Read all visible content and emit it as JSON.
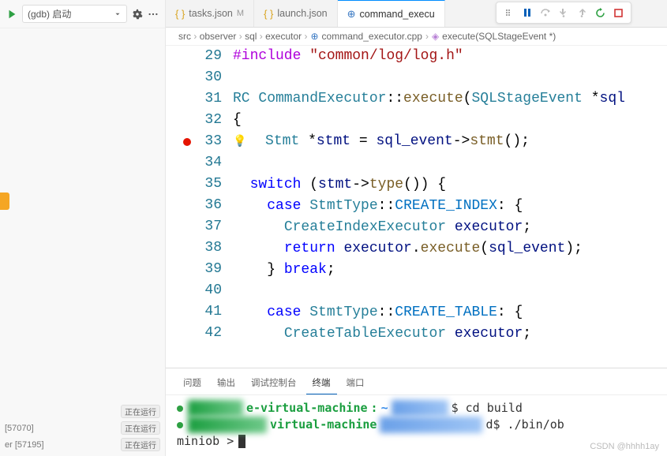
{
  "sidebar": {
    "config_label": "(gdb) 启动",
    "processes": [
      {
        "label": "[57070]",
        "status": "正在运行"
      },
      {
        "label": "er [57195]",
        "status": "正在运行"
      }
    ]
  },
  "tabs": [
    {
      "label": "tasks.json",
      "modified": "M",
      "icon": "json",
      "active": false
    },
    {
      "label": "launch.json",
      "icon": "json",
      "active": false
    },
    {
      "label": "command_execu",
      "icon": "cpp",
      "active": true
    }
  ],
  "breadcrumb": {
    "path": [
      "src",
      "observer",
      "sql",
      "executor"
    ],
    "file": "command_executor.cpp",
    "symbol": "execute(SQLStageEvent *)"
  },
  "editor": {
    "lines": [
      {
        "n": 29,
        "seg": [
          [
            "pp",
            "#include"
          ],
          [
            "punct",
            " "
          ],
          [
            "str",
            "\"common/log/log.h\""
          ]
        ]
      },
      {
        "n": 30,
        "seg": []
      },
      {
        "n": 31,
        "seg": [
          [
            "type",
            "RC "
          ],
          [
            "type",
            "CommandExecutor"
          ],
          [
            "punct",
            "::"
          ],
          [
            "fn",
            "execute"
          ],
          [
            "punct",
            "("
          ],
          [
            "type",
            "SQLStageEvent "
          ],
          [
            "punct",
            "*"
          ],
          [
            "ident",
            "sql"
          ]
        ]
      },
      {
        "n": 32,
        "seg": [
          [
            "punct",
            "{"
          ]
        ]
      },
      {
        "n": 33,
        "bulb": true,
        "bp": true,
        "seg": [
          [
            "punct",
            "  "
          ],
          [
            "type",
            "Stmt "
          ],
          [
            "punct",
            "*"
          ],
          [
            "ident",
            "stmt"
          ],
          [
            "punct",
            " = "
          ],
          [
            "ident",
            "sql_event"
          ],
          [
            "punct",
            "->"
          ],
          [
            "fn",
            "stmt"
          ],
          [
            "punct",
            "();"
          ]
        ]
      },
      {
        "n": 34,
        "seg": []
      },
      {
        "n": 35,
        "seg": [
          [
            "punct",
            "  "
          ],
          [
            "kw",
            "switch"
          ],
          [
            "punct",
            " ("
          ],
          [
            "ident",
            "stmt"
          ],
          [
            "punct",
            "->"
          ],
          [
            "fn",
            "type"
          ],
          [
            "punct",
            "()) {"
          ]
        ]
      },
      {
        "n": 36,
        "seg": [
          [
            "punct",
            "    "
          ],
          [
            "kw",
            "case"
          ],
          [
            "punct",
            " "
          ],
          [
            "type",
            "StmtType"
          ],
          [
            "punct",
            "::"
          ],
          [
            "const",
            "CREATE_INDEX"
          ],
          [
            "punct",
            ": {"
          ]
        ]
      },
      {
        "n": 37,
        "seg": [
          [
            "punct",
            "      "
          ],
          [
            "type",
            "CreateIndexExecutor "
          ],
          [
            "ident",
            "executor"
          ],
          [
            "punct",
            ";"
          ]
        ]
      },
      {
        "n": 38,
        "seg": [
          [
            "punct",
            "      "
          ],
          [
            "kw",
            "return"
          ],
          [
            "punct",
            " "
          ],
          [
            "ident",
            "executor"
          ],
          [
            "punct",
            "."
          ],
          [
            "fn",
            "execute"
          ],
          [
            "punct",
            "("
          ],
          [
            "ident",
            "sql_event"
          ],
          [
            "punct",
            ");"
          ]
        ]
      },
      {
        "n": 39,
        "seg": [
          [
            "punct",
            "    } "
          ],
          [
            "kw",
            "break"
          ],
          [
            "punct",
            ";"
          ]
        ]
      },
      {
        "n": 40,
        "seg": []
      },
      {
        "n": 41,
        "seg": [
          [
            "punct",
            "    "
          ],
          [
            "kw",
            "case"
          ],
          [
            "punct",
            " "
          ],
          [
            "type",
            "StmtType"
          ],
          [
            "punct",
            "::"
          ],
          [
            "const",
            "CREATE_TABLE"
          ],
          [
            "punct",
            ": {"
          ]
        ]
      },
      {
        "n": 42,
        "seg": [
          [
            "punct",
            "      "
          ],
          [
            "type",
            "CreateTableExecutor "
          ],
          [
            "ident",
            "executor"
          ],
          [
            "punct",
            ";"
          ]
        ]
      }
    ]
  },
  "panel": {
    "tabs": [
      "问题",
      "输出",
      "调试控制台",
      "终端",
      "端口"
    ],
    "active_tab": 3,
    "terminal": {
      "line1_host": "e-virtual-machine",
      "line1_sep": ":",
      "line1_cmd": "$ cd build",
      "line2_host": "virtual-machine",
      "line2_cmd": "d$ ./bin/ob",
      "line3_prompt": "miniob > "
    }
  },
  "watermark": "CSDN @hhhh1ay"
}
